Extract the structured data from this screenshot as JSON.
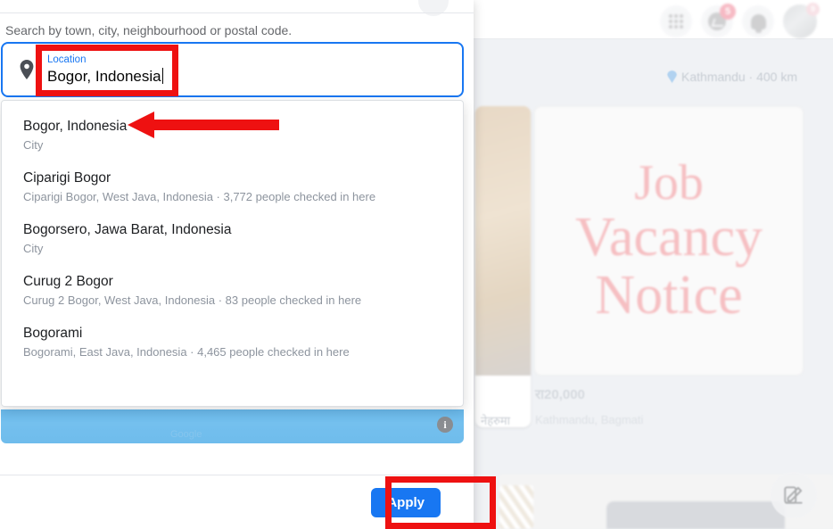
{
  "modal": {
    "hint": "Search by town, city, neighbourhood or postal code.",
    "close_label": "×",
    "field": {
      "label": "Location",
      "value": "Bogor, Indonesia",
      "placeholder": "Location"
    },
    "suggestions": [
      {
        "title": "Bogor, Indonesia",
        "subtitle": "City"
      },
      {
        "title": "Ciparigi Bogor",
        "subtitle": "Ciparigi Bogor, West Java, Indonesia · 3,772 people checked in here"
      },
      {
        "title": "Bogorsero, Jawa Barat, Indonesia",
        "subtitle": "City"
      },
      {
        "title": "Curug 2 Bogor",
        "subtitle": "Curug 2 Bogor, West Java, Indonesia · 83 people checked in here"
      },
      {
        "title": "Bogorami",
        "subtitle": "Bogorami, East Java, Indonesia · 4,465 people checked in here"
      }
    ],
    "map": {
      "info_glyph": "i",
      "ghost_label": "Google"
    },
    "footer": {
      "apply_label": "Apply"
    }
  },
  "background": {
    "topbar": {
      "messenger_badge": "5",
      "avatar_badge": "9"
    },
    "distance": "Kathmandu · 400 km",
    "listing": {
      "image_text_lines": [
        "Job",
        "Vacancy",
        "Notice"
      ],
      "price": "रा20,000",
      "location": "Kathmandu, Bagmati"
    },
    "side_listing_label": "नेहरुमा"
  },
  "annotations": {
    "input_highlight_color": "#ee1111",
    "apply_highlight_color": "#ee1111",
    "arrow_color": "#ee1111",
    "accent_color": "#1877f2"
  }
}
